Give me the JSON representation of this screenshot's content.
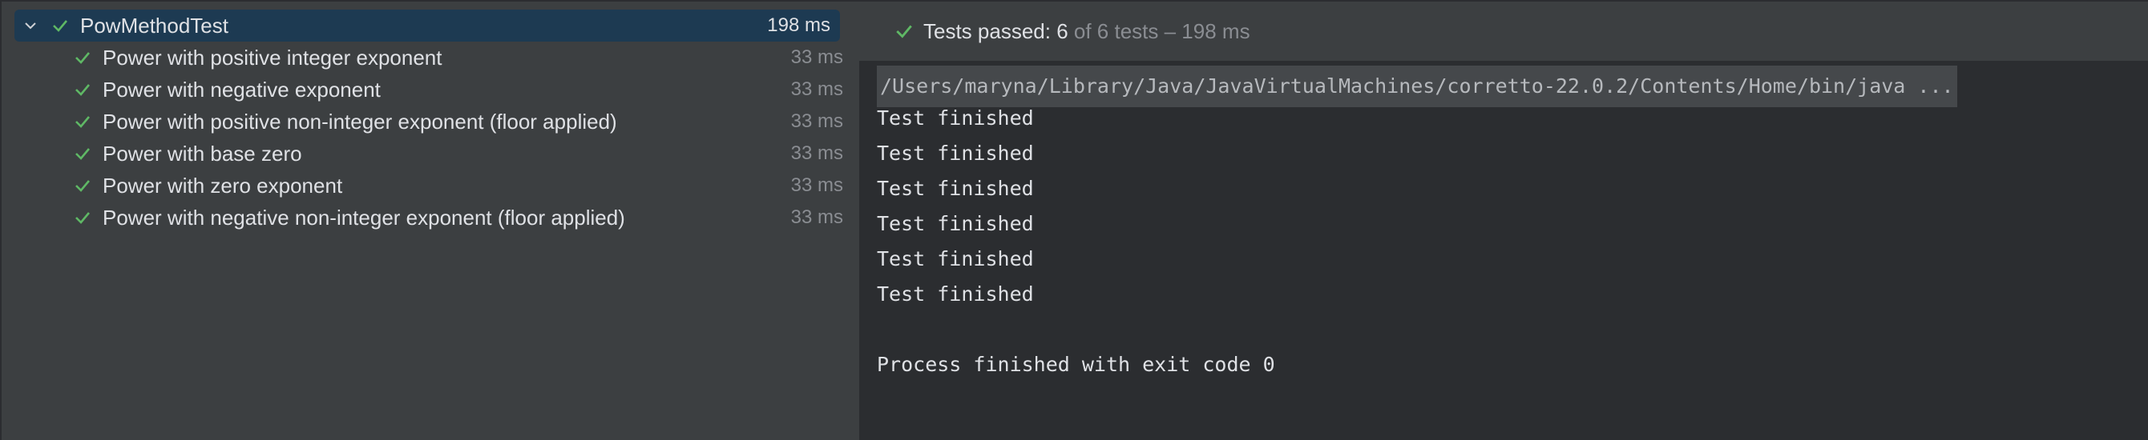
{
  "tree": {
    "root": {
      "name": "PowMethodTest",
      "time": "198 ms",
      "status": "passed"
    },
    "children": [
      {
        "name": "Power with positive integer exponent",
        "time": "33 ms"
      },
      {
        "name": "Power with negative exponent",
        "time": "33 ms"
      },
      {
        "name": "Power with positive non-integer exponent (floor applied)",
        "time": "33 ms"
      },
      {
        "name": "Power with base zero",
        "time": "33 ms"
      },
      {
        "name": "Power with zero exponent",
        "time": "33 ms"
      },
      {
        "name": "Power with negative non-integer exponent (floor applied)",
        "time": "33 ms"
      }
    ]
  },
  "status": {
    "label": "Tests passed: ",
    "passed": "6",
    "rest": " of 6 tests – 198 ms"
  },
  "console": {
    "command": "/Users/maryna/Library/Java/JavaVirtualMachines/corretto-22.0.2/Contents/Home/bin/java ...",
    "lines": [
      "Test finished",
      "Test finished",
      "Test finished",
      "Test finished",
      "Test finished",
      "Test finished"
    ],
    "exit": "Process finished with exit code 0"
  },
  "colors": {
    "pass": "#5fb865",
    "selection": "#1d3a52"
  },
  "icons": {
    "expand": "chevron-down-icon",
    "status": "checkmark-icon"
  }
}
